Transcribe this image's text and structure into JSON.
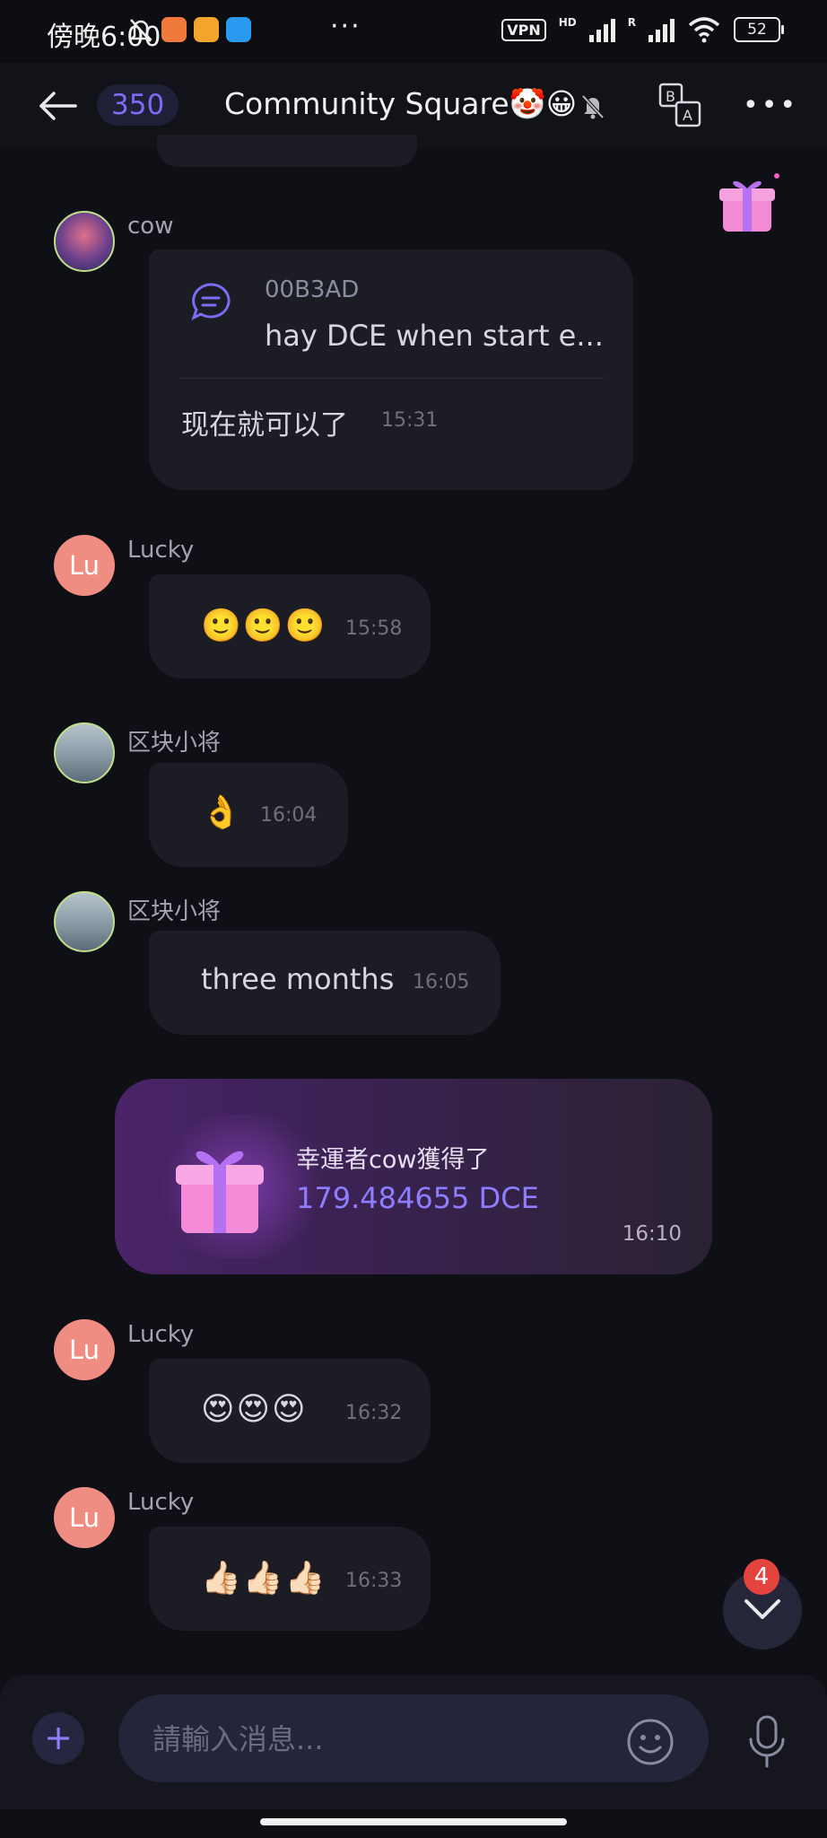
{
  "status_bar": {
    "time": "傍晚6:00",
    "more": "···",
    "vpn": "VPN",
    "network_hd": "HD",
    "network_r": "R",
    "battery": "52"
  },
  "header": {
    "member_count": "350",
    "title": "Community Square🤡😀",
    "more": "•••"
  },
  "messages": [
    {
      "sender": "cow",
      "reply": {
        "name": "00B3AD",
        "snippet": "hay DCE when start e..."
      },
      "text": "现在就可以了",
      "time": "15:31"
    },
    {
      "sender": "Lucky",
      "avatar_text": "Lu",
      "text": "🙂🙂🙂",
      "time": "15:58"
    },
    {
      "sender": "区块小将",
      "text": "👌",
      "time": "16:04"
    },
    {
      "sender": "区块小将",
      "text": "three months",
      "time": "16:05"
    },
    {
      "sender": "Lucky",
      "avatar_text": "Lu",
      "text": "😍😍😍",
      "time": "16:32"
    },
    {
      "sender": "Lucky",
      "avatar_text": "Lu",
      "text": "👍🏻👍🏻👍🏻",
      "time": "16:33"
    }
  ],
  "red_packet": {
    "line1": "幸運者cow獲得了",
    "amount": "179.484655 DCE",
    "time": "16:10"
  },
  "scroll_down": {
    "badge": "4"
  },
  "composer": {
    "plus": "+",
    "placeholder": "請輸入消息..."
  },
  "colors": {
    "background": "#0f0f16",
    "bubble": "#1c1c24",
    "accent": "#7b6cf6",
    "avatar_lu": "#f08d82",
    "badge": "#e5443e"
  },
  "icons": [
    "back-arrow-icon",
    "mute-bell-icon",
    "translate-icon",
    "more-icon",
    "gift-icon",
    "reply-quote-icon",
    "chevron-down-icon",
    "plus-icon",
    "smile-icon",
    "microphone-icon"
  ]
}
